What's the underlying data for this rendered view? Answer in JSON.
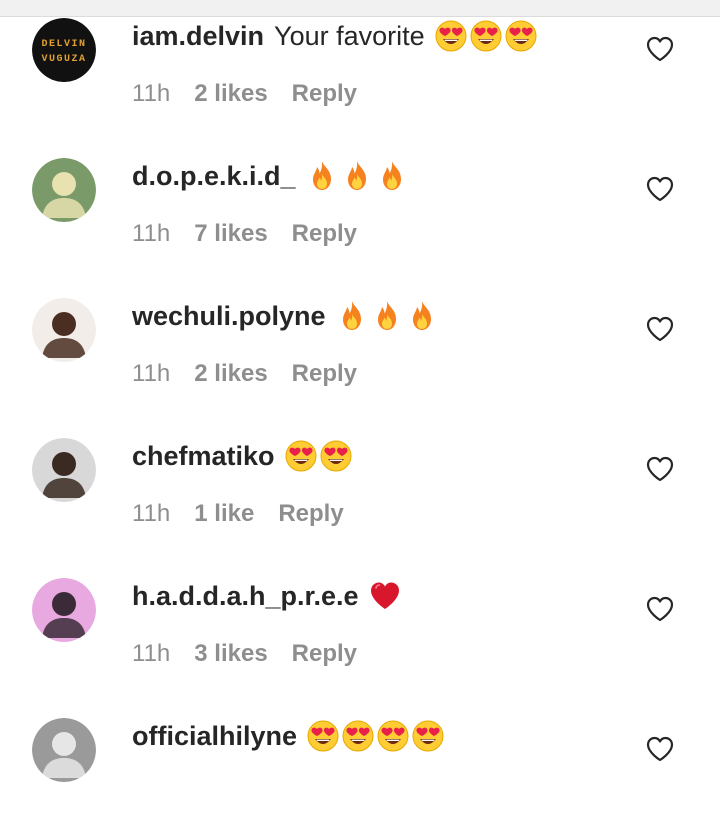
{
  "comments": [
    {
      "username": "iam.delvin",
      "text": "Your favorite",
      "emojis": [
        "heart-eyes-emoji",
        "heart-eyes-emoji",
        "heart-eyes-emoji"
      ],
      "time": "11h",
      "likes": "2 likes",
      "reply": "Reply",
      "avatar": {
        "type": "logo",
        "lines": [
          "DELVIN",
          "VUGUZA"
        ],
        "bg": "#111111",
        "fg": "#e0a030"
      }
    },
    {
      "username": "d.o.p.e.k.i.d_",
      "text": "",
      "emojis": [
        "fire-emoji",
        "fire-emoji",
        "fire-emoji"
      ],
      "time": "11h",
      "likes": "7 likes",
      "reply": "Reply",
      "avatar": {
        "type": "photo",
        "bg": "#7a9a6a",
        "accent": "#e8e2b0"
      }
    },
    {
      "username": "wechuli.polyne",
      "text": "",
      "emojis": [
        "fire-emoji",
        "fire-emoji",
        "fire-emoji"
      ],
      "time": "11h",
      "likes": "2 likes",
      "reply": "Reply",
      "avatar": {
        "type": "photo",
        "bg": "#f2ede8",
        "accent": "#4a2e22"
      }
    },
    {
      "username": "chefmatiko",
      "text": "",
      "emojis": [
        "heart-eyes-emoji",
        "heart-eyes-emoji"
      ],
      "time": "11h",
      "likes": "1 like",
      "reply": "Reply",
      "avatar": {
        "type": "photo",
        "bg": "#d8d8d8",
        "accent": "#3a2a22"
      }
    },
    {
      "username": "h.a.d.d.a.h_p.r.e.e",
      "text": "",
      "emojis": [
        "red-heart-emoji"
      ],
      "time": "11h",
      "likes": "3 likes",
      "reply": "Reply",
      "avatar": {
        "type": "photo",
        "bg": "#e8a8e0",
        "accent": "#3b2a38"
      }
    },
    {
      "username": "officialhilyne",
      "text": "",
      "emojis": [
        "heart-eyes-emoji",
        "heart-eyes-emoji",
        "heart-eyes-emoji",
        "heart-eyes-emoji"
      ],
      "time": "",
      "likes": "",
      "reply": "",
      "avatar": {
        "type": "photo",
        "bg": "#9a9a9a",
        "accent": "#e6e6e6"
      }
    }
  ],
  "colors": {
    "username": "#262626",
    "meta": "#8e8e8e",
    "heart_outline": "#262626",
    "emoji_face": "#ffcc33",
    "emoji_heart": "#e8204a",
    "fire_outer": "#f5821f",
    "fire_inner": "#ffd23f"
  },
  "icons": {
    "like": "heart-outline-icon"
  }
}
